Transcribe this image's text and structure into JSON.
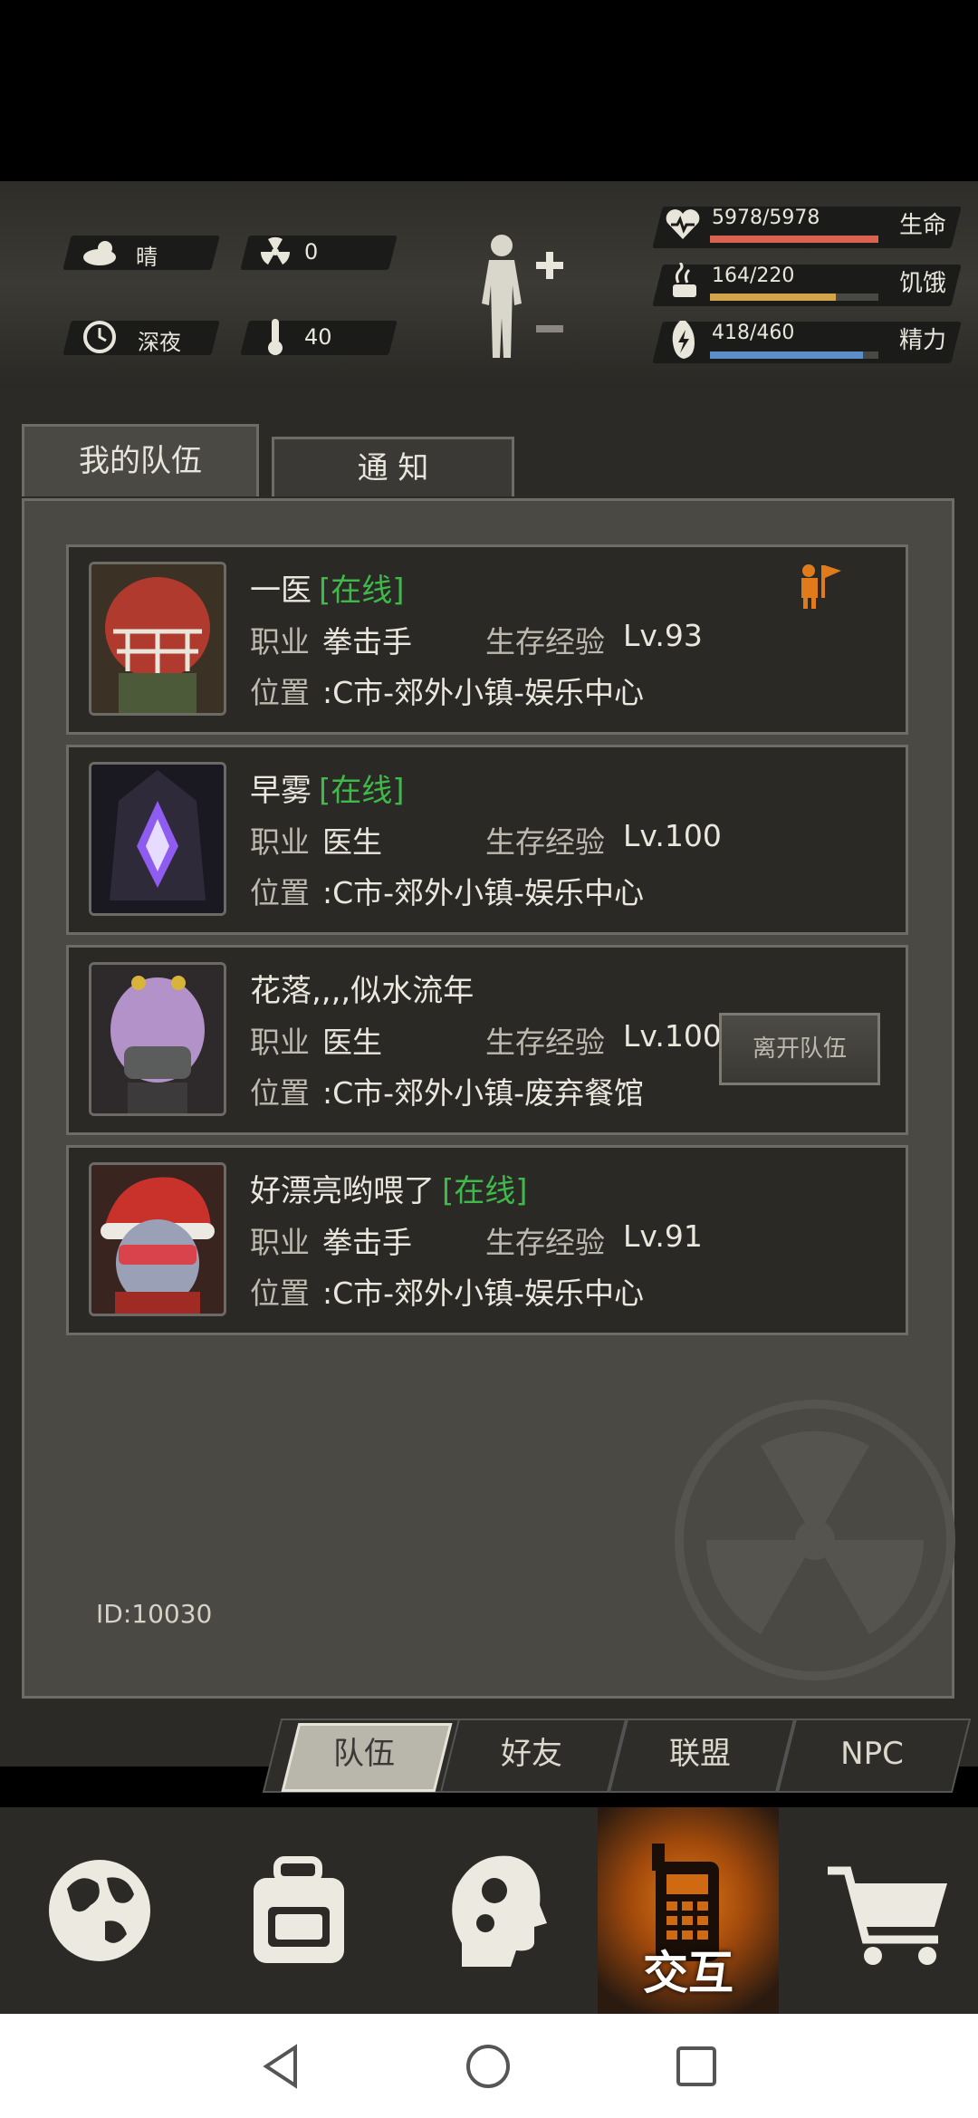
{
  "status": {
    "weather": "晴",
    "radiation": "0",
    "time_of_day": "深夜",
    "temperature": "40",
    "stats": [
      {
        "label": "生命",
        "value": "5978/5978",
        "fill": 1.0,
        "color": "#d9634e"
      },
      {
        "label": "饥饿",
        "value": "164/220",
        "fill": 0.745,
        "color": "#d4a44a"
      },
      {
        "label": "精力",
        "value": "418/460",
        "fill": 0.909,
        "color": "#5c8fc9"
      }
    ]
  },
  "tabs": [
    "我的队伍",
    "通 知"
  ],
  "members": [
    {
      "name": "一医",
      "status": "[在线]",
      "job_label": "职业",
      "job": "拳击手",
      "exp_label": "生存经验",
      "level": "Lv.93",
      "loc_label": "位置",
      "location": ":C市-郊外小镇-娱乐中心",
      "icon": "leader-flag-icon"
    },
    {
      "name": "早雾",
      "status": "[在线]",
      "job_label": "职业",
      "job": "医生",
      "exp_label": "生存经验",
      "level": "Lv.100",
      "loc_label": "位置",
      "location": ":C市-郊外小镇-娱乐中心"
    },
    {
      "name": "花落,,,,似水流年",
      "status": "",
      "job_label": "职业",
      "job": "医生",
      "exp_label": "生存经验",
      "level": "Lv.100",
      "loc_label": "位置",
      "location": ":C市-郊外小镇-废弃餐馆",
      "action": "离开队伍"
    },
    {
      "name": "好漂亮哟喂了",
      "status": "[在线]",
      "job_label": "职业",
      "job": "拳击手",
      "exp_label": "生存经验",
      "level": "Lv.91",
      "loc_label": "位置",
      "location": ":C市-郊外小镇-娱乐中心"
    }
  ],
  "player_id": "ID:10030",
  "subtabs": [
    "队伍",
    "好友",
    "联盟",
    "NPC"
  ],
  "nav": {
    "active_label": "交互",
    "items": [
      "globe-icon",
      "backpack-icon",
      "skills-head-icon",
      "interact-phone-icon",
      "cart-icon"
    ]
  }
}
